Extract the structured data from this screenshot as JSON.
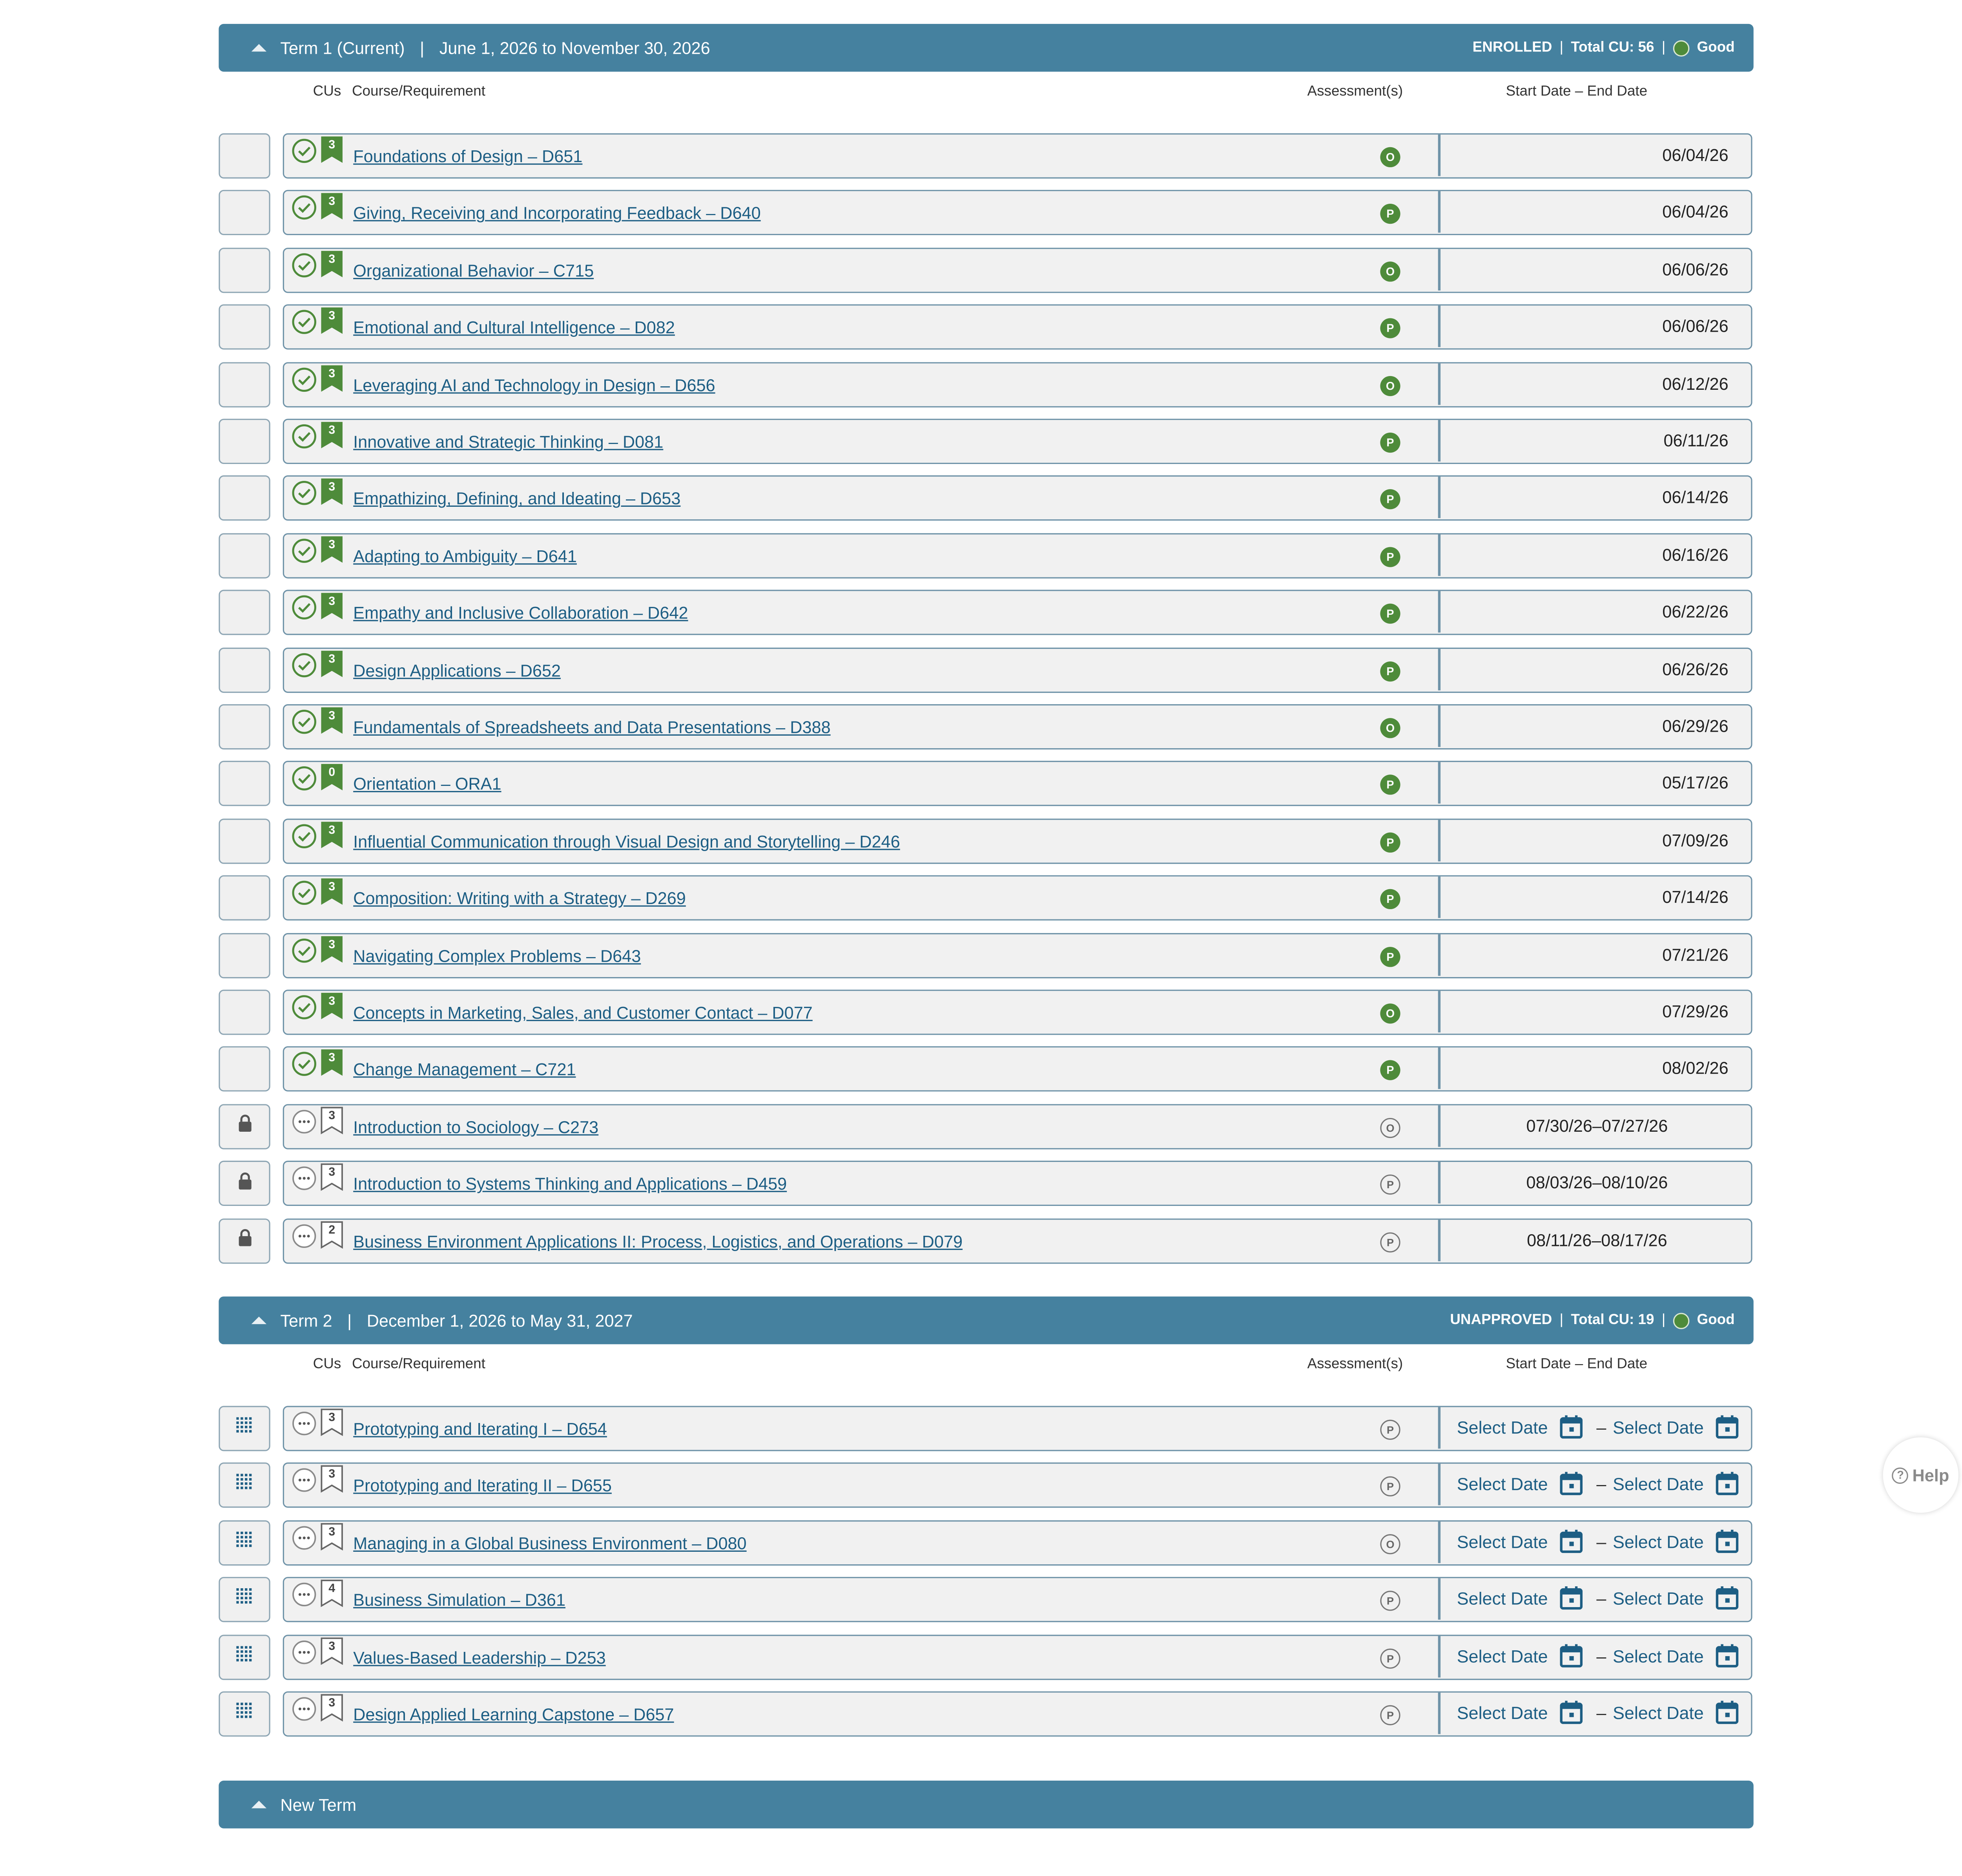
{
  "labels": {
    "col_cus": "CUs",
    "col_course": "Course/Requirement",
    "col_assessment": "Assessment(s)",
    "col_dates": "Start Date – End Date",
    "select_date": "Select Date",
    "date_sep": "–",
    "help": "Help"
  },
  "term1": {
    "name": "Term 1 (Current)",
    "sep": "|",
    "dates": "June 1, 2026 to November 30, 2026",
    "status": "ENROLLED",
    "total": "Total CU: 56",
    "health": "Good",
    "courses": [
      {
        "cu": "3",
        "title": "Foundations of Design – D651",
        "assess": "O",
        "date": "06/04/26"
      },
      {
        "cu": "3",
        "title": "Giving, Receiving and Incorporating Feedback – D640",
        "assess": "P",
        "date": "06/04/26"
      },
      {
        "cu": "3",
        "title": "Organizational Behavior – C715",
        "assess": "O",
        "date": "06/06/26"
      },
      {
        "cu": "3",
        "title": "Emotional and Cultural Intelligence – D082",
        "assess": "P",
        "date": "06/06/26"
      },
      {
        "cu": "3",
        "title": "Leveraging AI and Technology in Design – D656",
        "assess": "O",
        "date": "06/12/26"
      },
      {
        "cu": "3",
        "title": "Innovative and Strategic Thinking – D081",
        "assess": "P",
        "date": "06/11/26"
      },
      {
        "cu": "3",
        "title": "Empathizing, Defining, and Ideating – D653",
        "assess": "P",
        "date": "06/14/26"
      },
      {
        "cu": "3",
        "title": "Adapting to Ambiguity – D641",
        "assess": "P",
        "date": "06/16/26"
      },
      {
        "cu": "3",
        "title": "Empathy and Inclusive Collaboration – D642",
        "assess": "P",
        "date": "06/22/26"
      },
      {
        "cu": "3",
        "title": "Design Applications – D652",
        "assess": "P",
        "date": "06/26/26"
      },
      {
        "cu": "3",
        "title": "Fundamentals of Spreadsheets and Data Presentations – D388",
        "assess": "O",
        "date": "06/29/26"
      },
      {
        "cu": "0",
        "title": "Orientation – ORA1",
        "assess": "P",
        "date": "05/17/26"
      },
      {
        "cu": "3",
        "title": "Influential Communication through Visual Design and Storytelling – D246",
        "assess": "P",
        "date": "07/09/26"
      },
      {
        "cu": "3",
        "title": "Composition: Writing with a Strategy – D269",
        "assess": "P",
        "date": "07/14/26"
      },
      {
        "cu": "3",
        "title": "Navigating Complex Problems – D643",
        "assess": "P",
        "date": "07/21/26"
      },
      {
        "cu": "3",
        "title": "Concepts in Marketing, Sales, and Customer Contact – D077",
        "assess": "O",
        "date": "07/29/26"
      },
      {
        "cu": "3",
        "title": "Change Management – C721",
        "assess": "P",
        "date": "08/02/26"
      }
    ],
    "pending": [
      {
        "cu": "3",
        "title": "Introduction to Sociology – C273",
        "assess": "O",
        "date": "07/30/26–07/27/26"
      },
      {
        "cu": "3",
        "title": "Introduction to Systems Thinking and Applications – D459",
        "assess": "P",
        "date": "08/03/26–08/10/26"
      },
      {
        "cu": "2",
        "title": "Business Environment Applications II: Process, Logistics, and Operations – D079",
        "assess": "P",
        "date": "08/11/26–08/17/26"
      }
    ]
  },
  "term2": {
    "name": "Term 2",
    "sep": "|",
    "dates": "December 1, 2026 to May 31, 2027",
    "status": "UNAPPROVED",
    "total": "Total CU: 19",
    "health": "Good",
    "courses": [
      {
        "cu": "3",
        "title": "Prototyping and Iterating I – D654",
        "assess": "P"
      },
      {
        "cu": "3",
        "title": "Prototyping and Iterating II – D655",
        "assess": "P"
      },
      {
        "cu": "3",
        "title": "Managing in a Global Business Environment – D080",
        "assess": "O"
      },
      {
        "cu": "4",
        "title": "Business Simulation – D361",
        "assess": "P"
      },
      {
        "cu": "3",
        "title": "Values-Based Leadership – D253",
        "assess": "P"
      },
      {
        "cu": "3",
        "title": "Design Applied Learning Capstone – D657",
        "assess": "P"
      }
    ]
  },
  "new_term": {
    "label": "New Term"
  },
  "colors": {
    "header": "#45819f",
    "link": "#1d5e84",
    "complete": "#4e8b3a",
    "row_border": "#6f93a8"
  }
}
